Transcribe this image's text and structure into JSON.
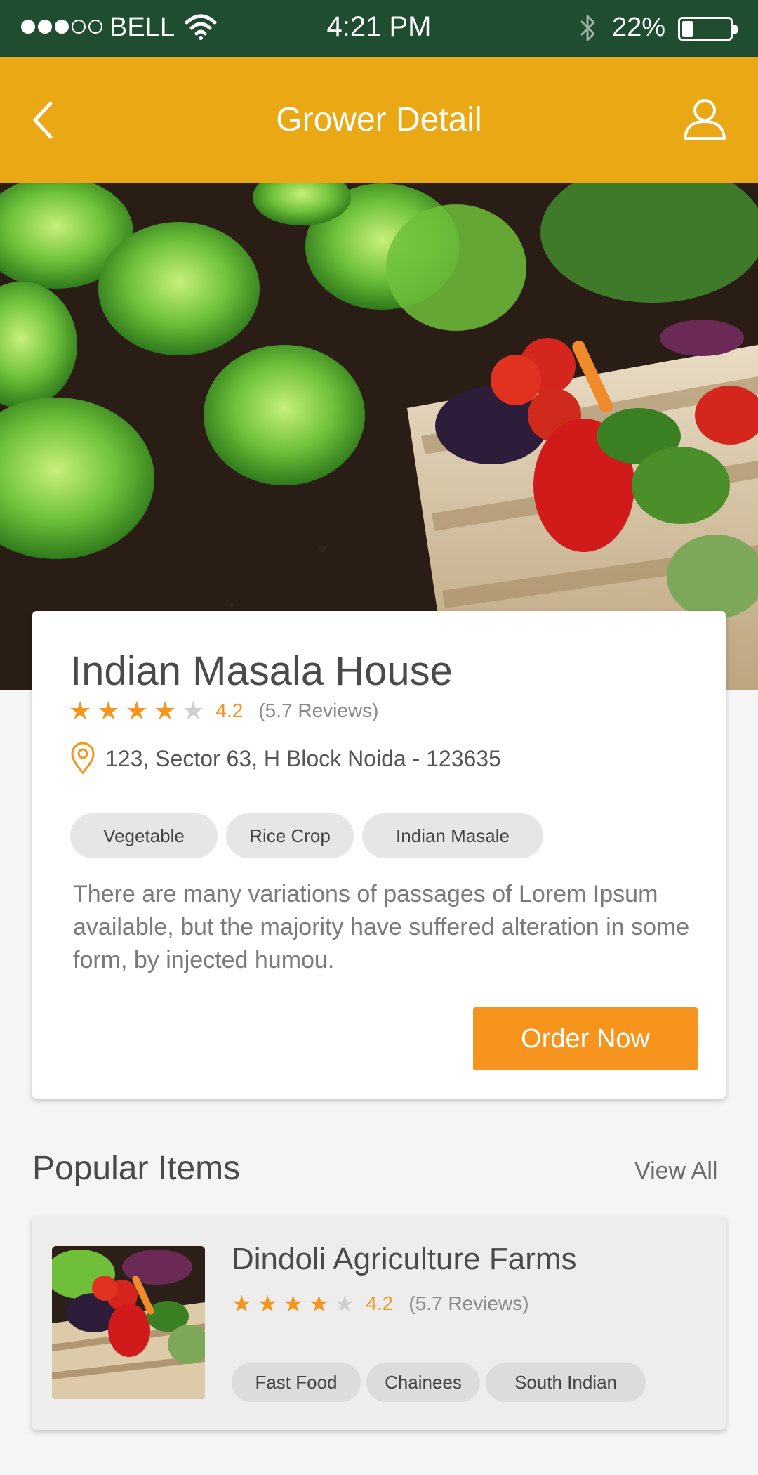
{
  "status_bar": {
    "carrier": "BELL",
    "time": "4:21 PM",
    "battery": "22%",
    "battery_level": 0.22,
    "signal_filled": 3,
    "signal_total": 5,
    "icons": [
      "wifi-icon",
      "bluetooth-icon",
      "battery-icon"
    ]
  },
  "header": {
    "title": "Grower Detail",
    "back_icon": "chevron-left-icon",
    "user_icon": "user-icon",
    "background": "#eaa814"
  },
  "grower": {
    "name": "Indian Masala House",
    "rating": "4.2",
    "rating_value": 4.2,
    "reviews": "(5.7 Reviews)",
    "address": "123, Sector 63, H Block Noida - 123635",
    "tags": [
      "Vegetable",
      "Rice Crop",
      "Indian Masale"
    ],
    "description": "There are many variations of passages of Lorem Ipsum available, but the majority have suffered alteration in some form, by injected humou.",
    "order_label": "Order Now"
  },
  "popular": {
    "title": "Popular Items",
    "view_all": "View All",
    "items": [
      {
        "name": "Dindoli Agriculture Farms",
        "rating": "4.2",
        "rating_value": 4.2,
        "reviews": "(5.7 Reviews)",
        "tags": [
          "Fast Food",
          "Chainees",
          "South Indian"
        ]
      }
    ]
  },
  "colors": {
    "status_bar": "#1f4d30",
    "accent": "#f7941d",
    "header": "#eaa814"
  }
}
